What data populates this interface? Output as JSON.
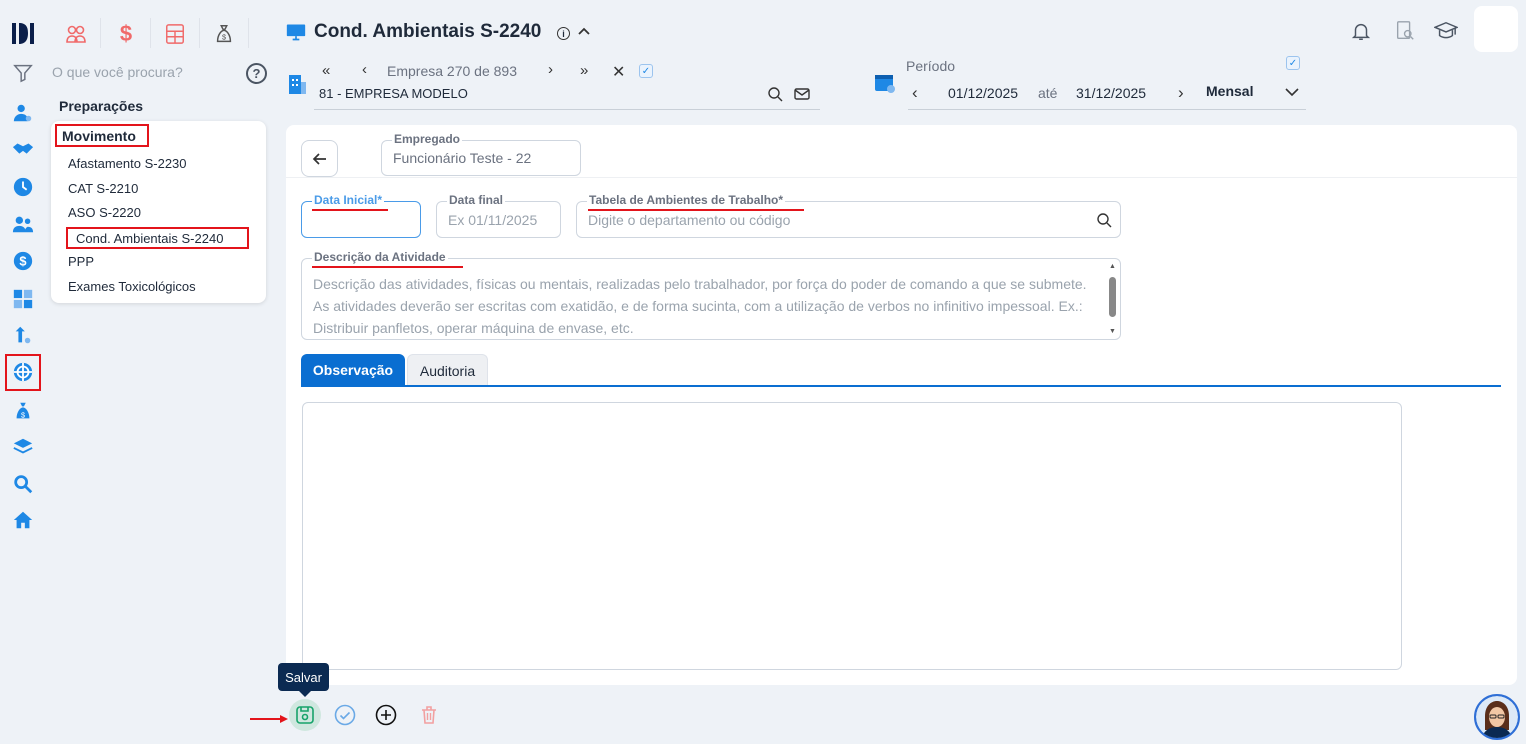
{
  "header": {
    "page_title": "Cond. Ambientais S-2240",
    "search_placeholder": "O que você procura?",
    "company_nav_text": "Empresa 270 de 893",
    "company_name": "81 - EMPRESA MODELO",
    "period_label": "Período",
    "period_start": "01/12/2025",
    "period_sep": "até",
    "period_end": "31/12/2025",
    "period_mode": "Mensal"
  },
  "menu": {
    "preparacoes": "Preparações",
    "movimento": "Movimento",
    "items": [
      "Afastamento S-2230",
      "CAT S-2210",
      "ASO S-2220",
      "Cond. Ambientais S-2240",
      "PPP",
      "Exames Toxicológicos"
    ]
  },
  "form": {
    "empregado_label": "Empregado",
    "empregado_value": "Funcionário Teste - 22",
    "data_inicial_label": "Data Inicial*",
    "data_final_label": "Data final",
    "data_final_placeholder": "Ex 01/11/2025",
    "tabela_label": "Tabela de Ambientes de Trabalho*",
    "tabela_placeholder": "Digite o departamento ou código",
    "descricao_label": "Descrição da Atividade",
    "descricao_placeholder": "Descrição das atividades, físicas ou mentais, realizadas pelo trabalhador, por força do poder de comando a que se submete. As atividades deverão ser escritas com exatidão, e de forma sucinta, com a utilização de verbos no infinitivo impessoal. Ex.: Distribuir panfletos, operar máquina de envase, etc."
  },
  "tabs": [
    "Observação",
    "Auditoria"
  ],
  "footer": {
    "save_tooltip": "Salvar"
  },
  "colors": {
    "primary": "#0a6ed1",
    "brand": "#0b1f4a",
    "red": "#e3141b",
    "sidebar_icon": "#1e88e5"
  },
  "icons": {
    "rail": [
      "filter-icon",
      "person-settings-icon",
      "handshake-icon",
      "clock-icon",
      "people-icon",
      "dollar-icon",
      "calculator-icon",
      "upload-person-icon",
      "crosshair-icon",
      "money-bag-icon",
      "layers-icon",
      "search-icon",
      "home-icon"
    ],
    "top": [
      "people-icon",
      "dollar-icon",
      "calculator-icon",
      "money-bag-icon"
    ],
    "right": [
      "bell-icon",
      "report-search-icon",
      "graduation-cap-icon"
    ]
  }
}
